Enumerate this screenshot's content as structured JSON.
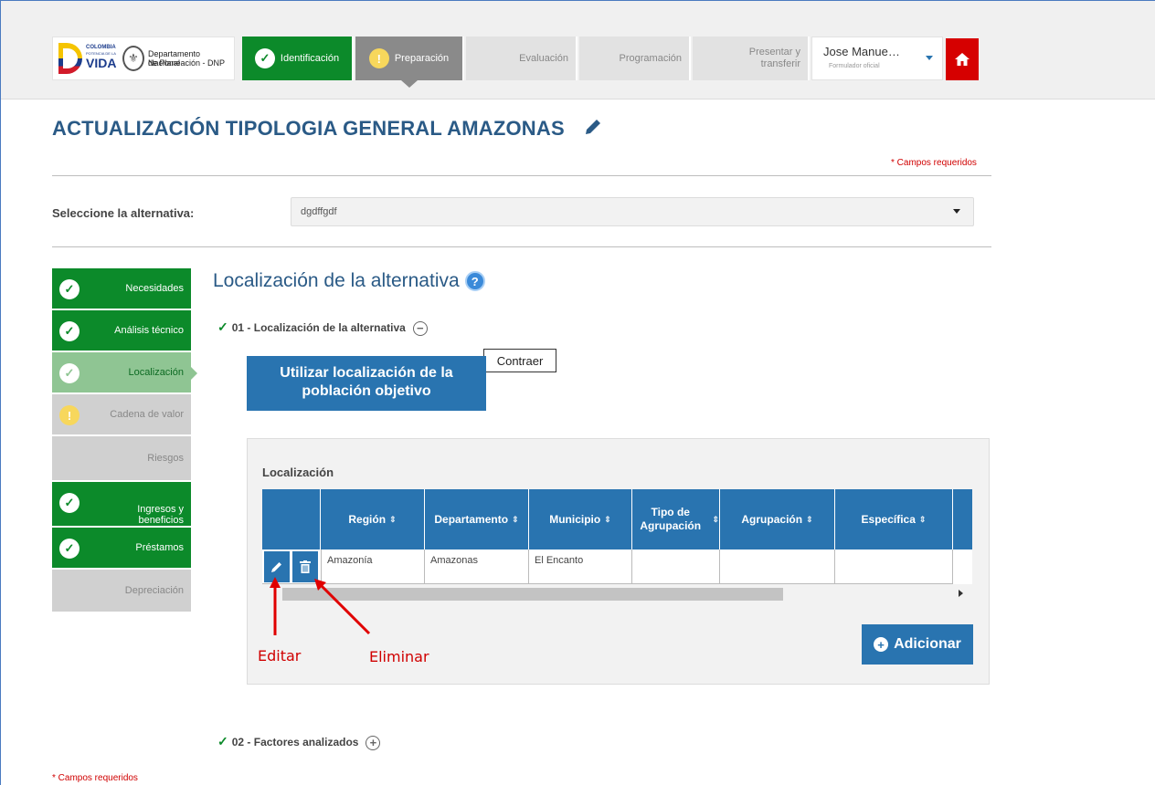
{
  "header": {
    "logo": {
      "line1": "COLOMBIA",
      "line2": "POTENCIA DE LA",
      "line3": "VIDA",
      "dnp1": "Departamento Nacional",
      "dnp2": "de Planeación - DNP"
    },
    "steps": [
      {
        "label": "Identificación",
        "state": "done"
      },
      {
        "label": "Preparación",
        "state": "current"
      },
      {
        "label": "Evaluación",
        "state": "pending"
      },
      {
        "label": "Programación",
        "state": "pending"
      },
      {
        "label_line1": "Presentar y",
        "label_line2": "transferir",
        "state": "pending"
      }
    ],
    "user": {
      "name": "Jose Manue…",
      "role": "Formulador oficial"
    },
    "home_icon": "home-icon"
  },
  "page": {
    "title": "ACTUALIZACIÓN TIPOLOGIA GENERAL AMAZONAS",
    "required_note": "* Campos requeridos",
    "alt_label": "Seleccione la alternativa:",
    "alt_value": "dgdffgdf"
  },
  "sidebar": {
    "items": [
      {
        "label": "Necesidades",
        "state": "done"
      },
      {
        "label": "Análisis técnico",
        "state": "done"
      },
      {
        "label": "Localización",
        "state": "active"
      },
      {
        "label": "Cadena de valor",
        "state": "warning"
      },
      {
        "label": "Riesgos",
        "state": "pending"
      },
      {
        "label_line1": "Ingresos y",
        "label_line2": "beneficios",
        "state": "done"
      },
      {
        "label": "Préstamos",
        "state": "done"
      },
      {
        "label": "Depreciación",
        "state": "pending"
      }
    ]
  },
  "section": {
    "title": "Localización de la alternativa",
    "sub1": "01 - Localización de la alternativa",
    "tooltip": "Contraer",
    "use_button_line1": "Utilizar localización de la",
    "use_button_line2": "población objetivo",
    "panel_title": "Localización",
    "columns": [
      "Región",
      "Departamento",
      "Municipio",
      "Tipo de Agrupación",
      "Agrupación",
      "Específica"
    ],
    "rows": [
      {
        "region": "Amazonía",
        "departamento": "Amazonas",
        "municipio": "El Encanto",
        "tipo": "",
        "agrupacion": "",
        "especifica": ""
      }
    ],
    "add_button": "Adicionar",
    "sub2": "02 - Factores analizados"
  },
  "annotations": {
    "edit": "Editar",
    "delete": "Eliminar"
  },
  "footer": {
    "required_note": "* Campos requeridos"
  },
  "colors": {
    "primary": "#2974b0",
    "success": "#0c8a2a",
    "title": "#2a5a86",
    "danger": "#d60000",
    "annotation": "#d00000"
  }
}
